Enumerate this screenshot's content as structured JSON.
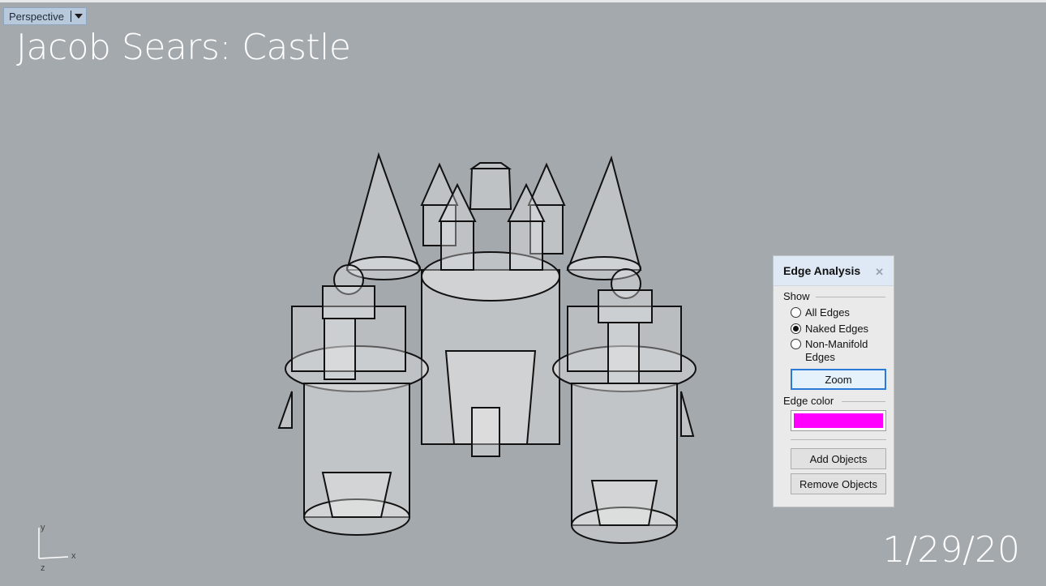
{
  "viewport": {
    "tab_label": "Perspective",
    "title_text": "Jacob Sears: Castle",
    "date_text": "1/29/20",
    "axes": {
      "y": "y",
      "x": "x",
      "z": "z"
    },
    "background_color": "#a4a9ae"
  },
  "panel": {
    "title": "Edge Analysis",
    "close_icon": "close-icon",
    "show_label": "Show",
    "options": [
      {
        "label": "All Edges",
        "selected": false
      },
      {
        "label": "Naked Edges",
        "selected": true
      },
      {
        "label": "Non-Manifold",
        "label2": "Edges",
        "selected": false
      }
    ],
    "zoom_label": "Zoom",
    "edge_color_label": "Edge color",
    "edge_color": "#ff00ff",
    "add_label": "Add Objects",
    "remove_label": "Remove Objects"
  }
}
